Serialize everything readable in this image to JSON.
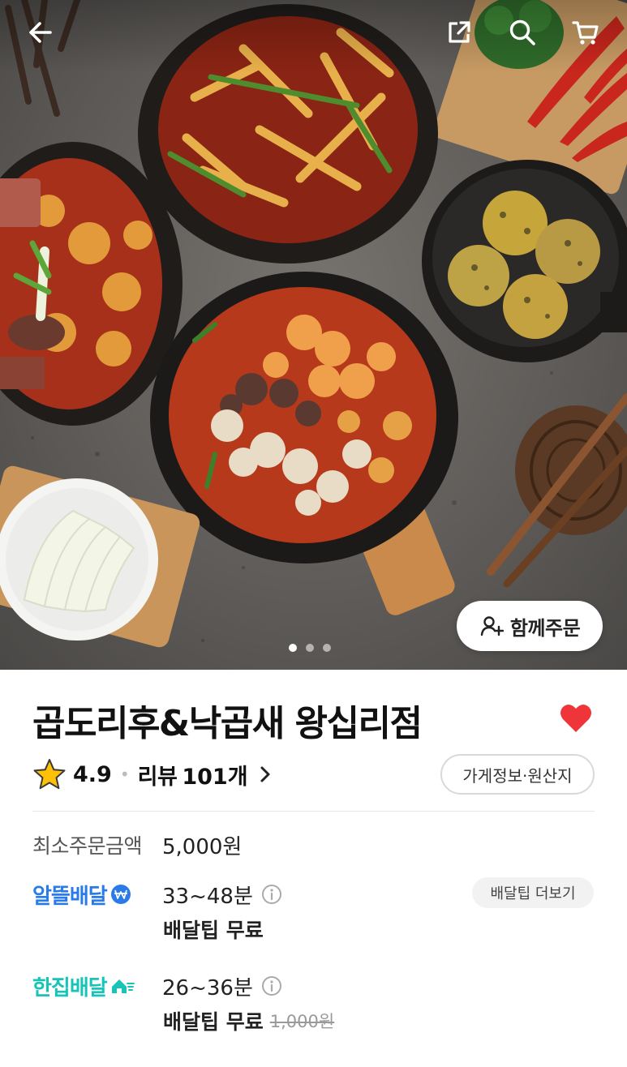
{
  "header": {
    "back_icon": "arrow-left-icon",
    "share_icon": "share-icon",
    "search_icon": "search-icon",
    "cart_icon": "cart-icon"
  },
  "hero": {
    "group_order_label": "함께주문",
    "group_order_icon": "person-add-icon",
    "carousel_total": 3,
    "carousel_active": 1
  },
  "store": {
    "name": "곱도리후&낙곱새 왕십리점",
    "favorite": true,
    "rating": "4.9",
    "review_label": "리뷰",
    "review_count": "101개",
    "info_button": "가게정보·원산지"
  },
  "order": {
    "min_order_label": "최소주문금액",
    "min_order_value": "5,000원"
  },
  "delivery": {
    "saver": {
      "label": "알뜰배달",
      "time": "33~48분",
      "tip": "배달팁 무료",
      "more_button": "배달팁 더보기"
    },
    "single": {
      "label": "한집배달",
      "time": "26~36분",
      "tip": "배달팁 무료",
      "original_tip": "1,000원"
    }
  },
  "colors": {
    "accent_blue": "#2a7be8",
    "accent_teal": "#18c4b8",
    "heart_red": "#f0353a",
    "star_yellow": "#ffc107"
  }
}
